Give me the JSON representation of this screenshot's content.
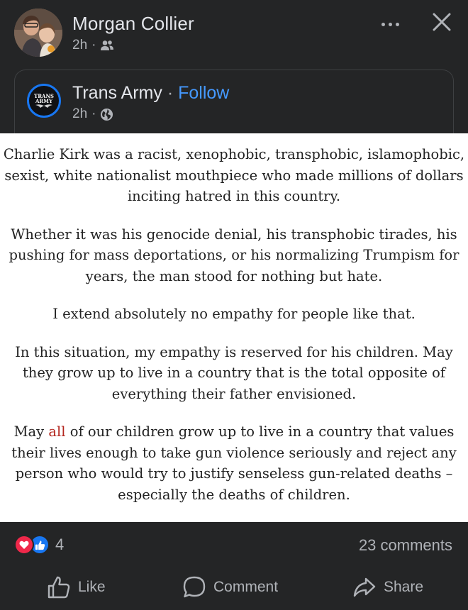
{
  "post": {
    "author": "Morgan Collier",
    "time": "2h",
    "separator": "·",
    "audience_icon": "friends-icon"
  },
  "shared": {
    "page_name": "Trans Army",
    "separator": "·",
    "follow_label": "Follow",
    "time": "2h",
    "audience_icon": "globe-icon",
    "logo_text_1": "TRANS",
    "logo_text_2": "ARMY"
  },
  "image_text": {
    "p1": "Charlie Kirk was a racist, xenophobic, transphobic, islamophobic, sexist, white nationalist mouthpiece who made millions of dollars inciting hatred in this country.",
    "p2": "Whether it was his genocide denial, his transphobic tirades, his pushing for mass deportations, or his normalizing Trumpism for years, the man stood for nothing but hate.",
    "p3": "I extend absolutely no empathy for people like that.",
    "p4": "In this situation, my empathy is reserved for his children. May they grow up to live in a country that is the total opposite of everything their father envisioned.",
    "p5_before": "May ",
    "p5_accent": "all",
    "p5_after": " of our children grow up to live in a country that values their lives enough to take gun violence seriously and reject any person who would try to justify senseless gun-related deaths – especially the deaths of children.",
    "accent_color": "#b3261e"
  },
  "stats": {
    "reactions": [
      "love-icon",
      "like-icon"
    ],
    "reaction_count": "4",
    "comments": "23 comments"
  },
  "actions": {
    "like": "Like",
    "comment": "Comment",
    "share": "Share"
  },
  "colors": {
    "background": "#242526",
    "text_primary": "#e4e6eb",
    "text_secondary": "#b0b3b8",
    "follow_blue": "#4599ff",
    "like_blue": "#1877f2",
    "love_red": "#f0284a"
  }
}
